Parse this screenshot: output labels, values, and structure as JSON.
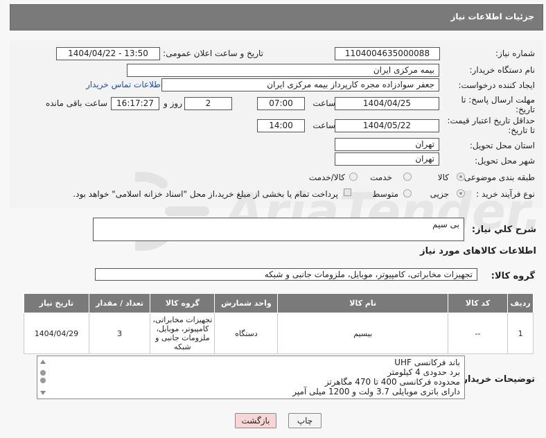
{
  "header": {
    "title": "جزئیات اطلاعات نیاز"
  },
  "form": {
    "need_number_label": "شماره نیاز:",
    "need_number": "1104004635000088",
    "announce_label": "تاریخ و ساعت اعلان عمومی:",
    "announce_value": "1404/04/22 - 13:50",
    "buyer_org_label": "نام دستگاه خریدار:",
    "buyer_org": "بیمه مرکزی ایران",
    "requester_label": "ایجاد کننده درخواست:",
    "requester": "جعفر سوادزاده مجره کارپرداز بیمه مرکزی ایران",
    "contact_link": "اطلاعات تماس خریدار",
    "deadline_label_1": "مهلت ارسال پاسخ: تا",
    "deadline_label_2": "تاریخ:",
    "deadline_date": "1404/04/25",
    "time_label": "ساعت",
    "deadline_time": "07:00",
    "days_value": "2",
    "days_label": "روز و",
    "remaining_time": "16:17:27",
    "remaining_label": "ساعت باقی مانده",
    "validity_label_1": "حداقل تاریخ اعتبار قیمت:",
    "validity_label_2": "تا تاریخ:",
    "validity_date": "1404/05/22",
    "validity_time": "14:00",
    "province_label": "استان محل تحویل:",
    "province": "تهران",
    "city_label": "شهر محل تحویل:",
    "city": "تهران",
    "category_label": "طبقه بندی موضوعی:",
    "category_options": [
      "کالا",
      "خدمت",
      "کالا/خدمت"
    ],
    "process_label": "نوع فرآیند خرید :",
    "process_options": [
      "جزیی",
      "متوسط"
    ],
    "payment_note": "پرداخت تمام یا بخشی از مبلغ خرید،از محل \"اسناد خزانه اسلامی\" خواهد بود."
  },
  "summary": {
    "label": "شرح کلي نياز:",
    "value": "بی سیم"
  },
  "goods_section": {
    "title": "اطلاعات کالاهای مورد نیاز",
    "group_label": "گروه کالا:",
    "group_value": "تجهیزات مخابراتی، کامپیوتر، موبایل، ملزومات جانبی و شبکه"
  },
  "table": {
    "headers": [
      "ردیف",
      "کد کالا",
      "نام کالا",
      "واحد شمارش",
      "گروه کالا",
      "تعداد / مقدار",
      "تاریخ نیاز"
    ],
    "rows": [
      {
        "row": "1",
        "code": "--",
        "name": "بیسیم",
        "unit": "دستگاه",
        "group": "تجهیزات مخابراتی، کامپیوتر، موبایل، ملزومات جانبی و شبکه",
        "qty": "3",
        "date": "1404/04/29"
      }
    ]
  },
  "notes": {
    "label": "توضیحات خریدار:",
    "lines": [
      "باند فرکانسی UHF",
      "برد حدودی 4 کیلومتر",
      "محدوده فرکانسی 400 تا 470 مگاهرتز",
      "دارای باتری موبایلی 3.7 ولت و 1200 میلی آمپر"
    ]
  },
  "buttons": {
    "print": "چاپ",
    "back": "بازگشت"
  },
  "watermark": {
    "text": "AriaTender.neT"
  },
  "colors": {
    "header_bg": "#7a7a7a",
    "link": "#1a4fb5",
    "back_btn": "#f9d6d6"
  }
}
